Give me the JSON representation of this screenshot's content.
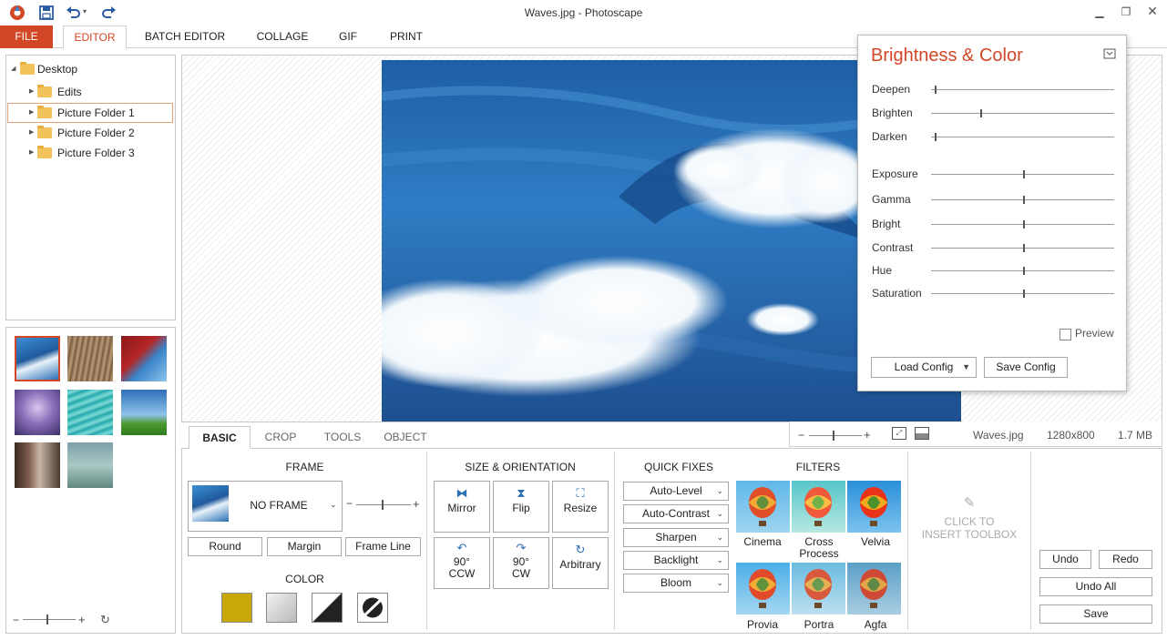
{
  "window": {
    "title": "Waves.jpg - Photoscape",
    "controls": [
      "minimize",
      "restore",
      "close"
    ]
  },
  "quick_access": {
    "icons": [
      "app-logo-icon",
      "save-icon",
      "undo-icon",
      "redo-icon"
    ]
  },
  "menu_tabs": [
    {
      "label": "FILE"
    },
    {
      "label": "EDITOR"
    },
    {
      "label": "BATCH EDITOR"
    },
    {
      "label": "COLLAGE"
    },
    {
      "label": "GIF"
    },
    {
      "label": "PRINT"
    }
  ],
  "active_menu_tab": "EDITOR",
  "folder_tree": {
    "root": "Desktop",
    "children": [
      "Edits",
      "Picture Folder 1",
      "Picture Folder 2",
      "Picture Folder 3"
    ],
    "selected": "Picture Folder 1"
  },
  "thumbnails": {
    "count": 8,
    "selected_index": 0
  },
  "image_info": {
    "filename": "Waves.jpg",
    "dimensions": "1280x800",
    "size": "1.7 MB"
  },
  "brightness_panel": {
    "title": "Brightness & Color",
    "sliders": [
      {
        "label": "Deepen",
        "value": 0.02
      },
      {
        "label": "Brighten",
        "value": 0.27
      },
      {
        "label": "Darken",
        "value": 0.02
      },
      {
        "label": "Exposure",
        "value": 0.5
      },
      {
        "label": "Gamma",
        "value": 0.5
      },
      {
        "label": "Bright",
        "value": 0.5
      },
      {
        "label": "Contrast",
        "value": 0.5
      },
      {
        "label": "Hue",
        "value": 0.5
      },
      {
        "label": "Saturation",
        "value": 0.5
      }
    ],
    "preview_label": "Preview",
    "preview_checked": false,
    "load_config": "Load Config",
    "save_config": "Save Config"
  },
  "bottom_tabs": [
    {
      "label": "BASIC"
    },
    {
      "label": "CROP"
    },
    {
      "label": "TOOLS"
    },
    {
      "label": "OBJECT"
    }
  ],
  "active_bottom_tab": "BASIC",
  "frame": {
    "title": "FRAME",
    "selected": "NO FRAME",
    "buttons": [
      "Round",
      "Margin",
      "Frame Line"
    ],
    "color_title": "COLOR"
  },
  "size_orientation": {
    "title": "SIZE & ORIENTATION",
    "tools": [
      {
        "label": "Mirror",
        "icon": "mirror-icon"
      },
      {
        "label": "Flip",
        "icon": "flip-icon"
      },
      {
        "label": "Resize",
        "icon": "resize-icon"
      },
      {
        "label_1": "90°",
        "label_2": "CCW",
        "icon": "rotate-ccw-icon"
      },
      {
        "label_1": "90°",
        "label_2": "CW",
        "icon": "rotate-cw-icon"
      },
      {
        "label": "Arbitrary",
        "icon": "rotate-arbitrary-icon"
      }
    ]
  },
  "quick_fixes": {
    "title": "QUICK FIXES",
    "items": [
      "Auto-Level",
      "Auto-Contrast",
      "Sharpen",
      "Backlight",
      "Bloom"
    ]
  },
  "filters": {
    "title": "FILTERS",
    "items": [
      "Cinema",
      "Cross Process",
      "Velvia",
      "Provia",
      "Portra",
      "Agfa"
    ]
  },
  "toolbox": {
    "line1": "CLICK TO",
    "line2": "INSERT TOOLBOX"
  },
  "history": {
    "undo": "Undo",
    "redo": "Redo",
    "undo_all": "Undo All",
    "save": "Save"
  },
  "zoom": {
    "minus": "−",
    "plus": "+"
  },
  "colors": {
    "accent": "#d24726",
    "icon_blue": "#2a6fb5",
    "swatch_gold": "#c9a80a"
  }
}
